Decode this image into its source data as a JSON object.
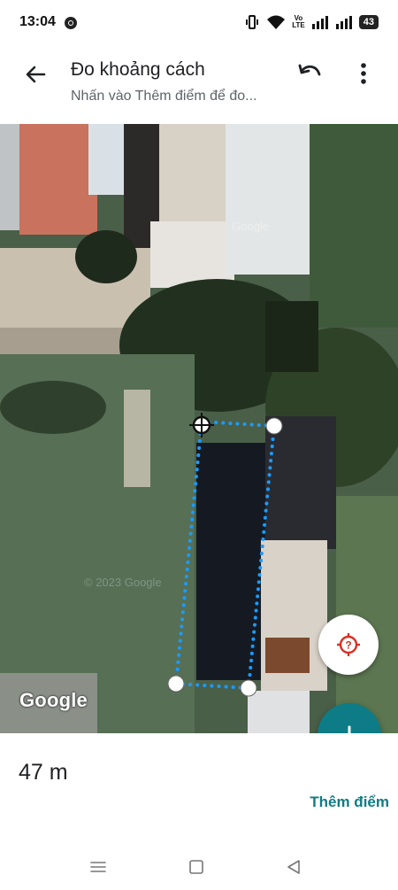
{
  "status_bar": {
    "time": "13:04",
    "volte_top": "Vo",
    "volte_bottom": "LTE",
    "battery": "43",
    "icons": [
      "chrome-icon",
      "vibrate-icon",
      "wifi-icon",
      "signal-icon",
      "signal-icon",
      "battery-icon"
    ]
  },
  "app_bar": {
    "title": "Đo khoảng cách",
    "subtitle": "Nhấn vào Thêm điểm để đo..."
  },
  "map": {
    "logo": "Google",
    "watermark": "Google",
    "accent_color": "#0e7c86",
    "line_color": "#1a9bff"
  },
  "bottom": {
    "distance": "47 m",
    "add_point": "Thêm điểm"
  },
  "nav": {
    "icons": [
      "menu-icon",
      "home-square-icon",
      "back-triangle-icon"
    ]
  }
}
